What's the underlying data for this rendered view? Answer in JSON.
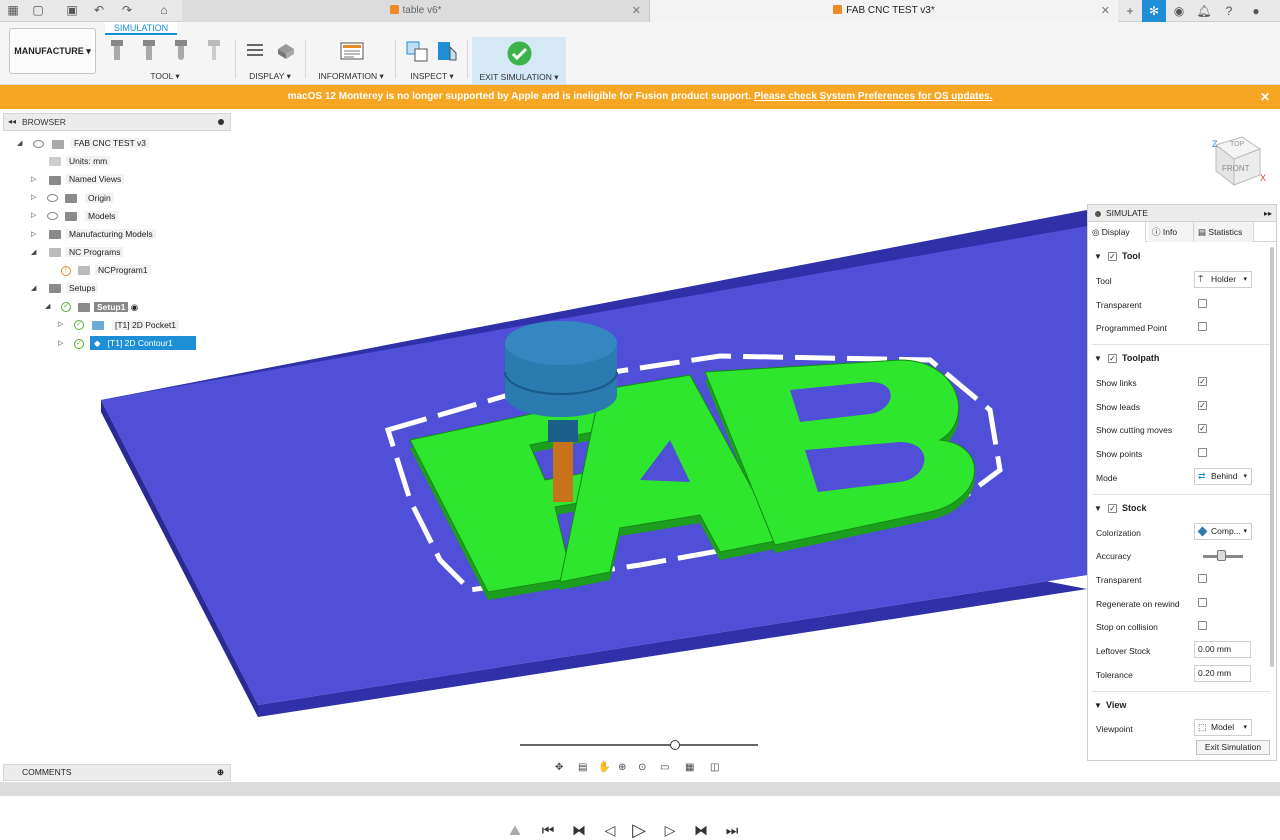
{
  "titlebar": {
    "tabs": [
      {
        "label": "table v6*"
      },
      {
        "label": "FAB CNC TEST v3*"
      }
    ]
  },
  "toolbar": {
    "workspace": "MANUFACTURE",
    "active_tab": "SIMULATION",
    "groups": [
      "TOOL",
      "DISPLAY",
      "INFORMATION",
      "INSPECT",
      "EXIT SIMULATION"
    ]
  },
  "banner": {
    "message": "macOS 12 Monterey is no longer supported by Apple and is ineligible for Fusion product support.",
    "link": "Please check System Preferences for OS updates."
  },
  "browser": {
    "title": "BROWSER",
    "items": [
      {
        "label": "FAB CNC TEST v3"
      },
      {
        "label": "Units: mm"
      },
      {
        "label": "Named Views"
      },
      {
        "label": "Origin"
      },
      {
        "label": "Models"
      },
      {
        "label": "Manufacturing Models"
      },
      {
        "label": "NC Programs"
      },
      {
        "label": "NCProgram1"
      },
      {
        "label": "Setups"
      },
      {
        "label": "Setup1"
      },
      {
        "label": "[T1] 2D Pocket1"
      },
      {
        "label": "[T1] 2D Contour1"
      }
    ]
  },
  "viewcube": {
    "top": "TOP",
    "front": "FRONT",
    "z": "Z",
    "x": "X"
  },
  "simulate": {
    "title": "SIMULATE",
    "tabs": [
      "Display",
      "Info",
      "Statistics"
    ],
    "sections": {
      "tool": "Tool",
      "toolpath": "Toolpath",
      "stock": "Stock",
      "view": "View"
    },
    "fields": {
      "tool": "Tool",
      "tool_value": "Holder",
      "transparent": "Transparent",
      "programmed_point": "Programmed Point",
      "show_links": "Show links",
      "show_leads": "Show leads",
      "show_cutting_moves": "Show cutting moves",
      "show_points": "Show points",
      "mode": "Mode",
      "mode_value": "Behind",
      "colorization": "Colorization",
      "colorization_value": "Comp...",
      "accuracy": "Accuracy",
      "stock_transparent": "Transparent",
      "regenerate": "Regenerate on rewind",
      "stop_collision": "Stop on collision",
      "leftover": "Leftover Stock",
      "leftover_value": "0.00 mm",
      "tolerance": "Tolerance",
      "tolerance_value": "0.20 mm",
      "viewpoint": "Viewpoint",
      "viewpoint_value": "Model"
    },
    "checks": {
      "tool": true,
      "transparent": false,
      "programmed_point": false,
      "toolpath": true,
      "show_links": true,
      "show_leads": true,
      "show_cutting_moves": true,
      "show_points": false,
      "stock": true,
      "stock_transparent": false,
      "regenerate": false,
      "stop_collision": false
    },
    "accuracy_level": 0.45,
    "exit_button": "Exit Simulation"
  },
  "comments": {
    "title": "COMMENTS"
  },
  "model": {
    "text": "FAB",
    "stock_color": "#4f4fd8",
    "part_color": "#2ee62e"
  },
  "playback": {
    "position": 0.65
  }
}
